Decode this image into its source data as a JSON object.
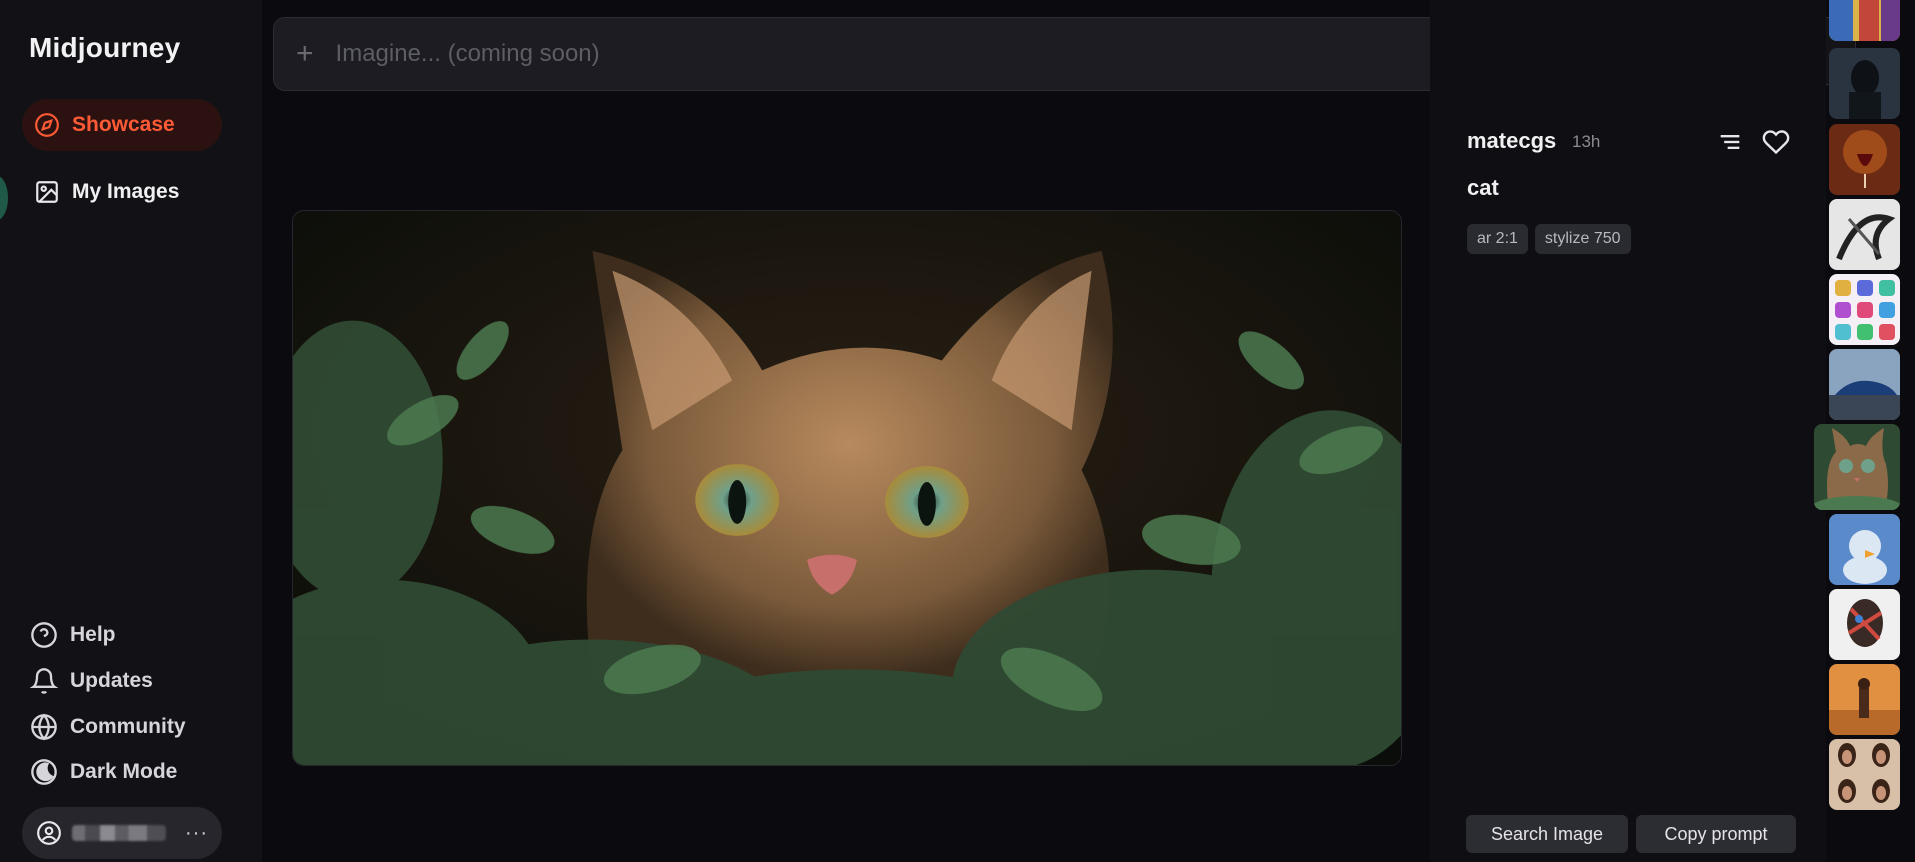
{
  "sidebar": {
    "brand": "Midjourney",
    "nav": [
      {
        "label": "Showcase",
        "icon": "compass-icon",
        "active": true
      },
      {
        "label": "My Images",
        "icon": "image-icon",
        "active": false
      }
    ],
    "bottom": [
      {
        "label": "Help",
        "icon": "help-circle-icon"
      },
      {
        "label": "Updates",
        "icon": "bell-icon"
      },
      {
        "label": "Community",
        "icon": "globe-icon"
      },
      {
        "label": "Dark Mode",
        "icon": "moon-icon"
      }
    ],
    "account": {
      "icon": "user-circle-icon",
      "more": "···"
    }
  },
  "search": {
    "placeholder": "Imagine... (coming soon)",
    "plus": "+"
  },
  "detail": {
    "author": "matecgs",
    "age": "13h",
    "prompt": "cat",
    "tags": [
      "ar 2:1",
      "stylize 750"
    ],
    "actions": {
      "search_image": "Search Image",
      "copy_prompt": "Copy prompt"
    }
  },
  "thumbnails": [
    {
      "name": "thumb-colorful-pattern"
    },
    {
      "name": "thumb-dark-figure"
    },
    {
      "name": "thumb-wine-glass"
    },
    {
      "name": "thumb-ink-sketch"
    },
    {
      "name": "thumb-colorful-icons"
    },
    {
      "name": "thumb-blue-car"
    },
    {
      "name": "thumb-cat",
      "active": true
    },
    {
      "name": "thumb-duck-toy"
    },
    {
      "name": "thumb-graffiti-portrait"
    },
    {
      "name": "thumb-desert-scene"
    },
    {
      "name": "thumb-portrait-grid"
    }
  ],
  "colors": {
    "accent": "#ff5a36",
    "background": "#0b0b0f",
    "sidebar": "#121216"
  }
}
